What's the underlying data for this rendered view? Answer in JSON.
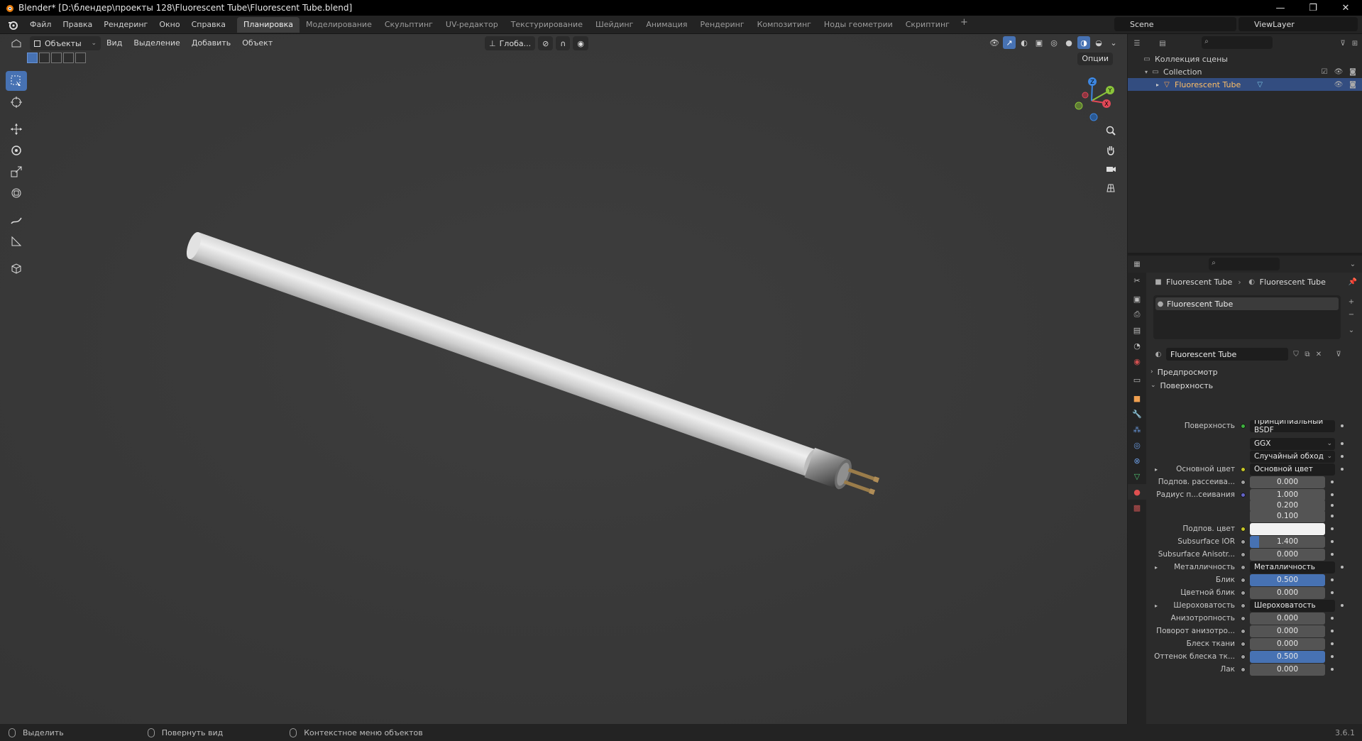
{
  "window": {
    "title": "Blender* [D:\\блендер\\проекты 128\\Fluorescent Tube\\Fluorescent Tube.blend]",
    "controls": [
      "—",
      "❐",
      "✕"
    ]
  },
  "menu": {
    "items": [
      "Файл",
      "Правка",
      "Рендеринг",
      "Окно",
      "Справка"
    ],
    "workspaces": [
      "Планировка",
      "Моделирование",
      "Скульптинг",
      "UV-редактор",
      "Текстурирование",
      "Шейдинг",
      "Анимация",
      "Рендеринг",
      "Композитинг",
      "Ноды геометрии",
      "Скриптинг"
    ],
    "active_workspace": "Планировка",
    "scene": "Scene",
    "view_layer": "ViewLayer"
  },
  "viewport": {
    "mode": "Объекты",
    "menus": [
      "Вид",
      "Выделение",
      "Добавить",
      "Объект"
    ],
    "orientation": "Глоба...",
    "options": "Опции",
    "gizmo_axes": {
      "x": "X",
      "y": "Y",
      "z": "Z"
    }
  },
  "outliner": {
    "scene_collection": "Коллекция сцены",
    "collection": "Collection",
    "object": "Fluorescent Tube"
  },
  "properties": {
    "breadcrumb_object": "Fluorescent Tube",
    "breadcrumb_material": "Fluorescent Tube",
    "slot": "Fluorescent Tube",
    "material_name": "Fluorescent Tube",
    "preview_label": "Предпросмотр",
    "surface_panel": "Поверхность",
    "rows": [
      {
        "label": "Поверхность",
        "type": "dark",
        "value": "Принципиальный BSDF",
        "socket": "#3fb33f"
      },
      {
        "label": "",
        "type": "dark",
        "value": "GGX",
        "socket": ""
      },
      {
        "label": "",
        "type": "dark",
        "value": "Случайный обход",
        "socket": ""
      },
      {
        "label": "Основной цвет",
        "type": "dark",
        "value": "Основной цвет",
        "socket": "#c7c729",
        "expand": true
      },
      {
        "label": "Подпов. рассеива...",
        "type": "num",
        "value": "0.000",
        "socket": "#a1a1a1"
      },
      {
        "label": "Радиус п...сеивания",
        "type": "num",
        "value": "1.000",
        "socket": "#6363c7"
      },
      {
        "label": "",
        "type": "num",
        "value": "0.200",
        "socket": ""
      },
      {
        "label": "",
        "type": "num",
        "value": "0.100",
        "socket": ""
      },
      {
        "label": "Подпов. цвет",
        "type": "white",
        "value": "",
        "socket": "#c7c729"
      },
      {
        "label": "Subsurface IOR",
        "type": "numfill",
        "value": "1.400",
        "socket": "#a1a1a1",
        "fill": 0.12
      },
      {
        "label": "Subsurface Anisotr...",
        "type": "num",
        "value": "0.000",
        "socket": "#a1a1a1"
      },
      {
        "label": "Металличность",
        "type": "dark",
        "value": "Металличность",
        "socket": "#a1a1a1",
        "expand": true
      },
      {
        "label": "Блик",
        "type": "blue",
        "value": "0.500",
        "socket": "#a1a1a1"
      },
      {
        "label": "Цветной блик",
        "type": "num",
        "value": "0.000",
        "socket": "#a1a1a1"
      },
      {
        "label": "Шероховатость",
        "type": "dark",
        "value": "Шероховатость",
        "socket": "#a1a1a1",
        "expand": true
      },
      {
        "label": "Анизотропность",
        "type": "num",
        "value": "0.000",
        "socket": "#a1a1a1"
      },
      {
        "label": "Поворот анизотро...",
        "type": "num",
        "value": "0.000",
        "socket": "#a1a1a1"
      },
      {
        "label": "Блеск ткани",
        "type": "num",
        "value": "0.000",
        "socket": "#a1a1a1"
      },
      {
        "label": "Оттенок блеска тк...",
        "type": "blue",
        "value": "0.500",
        "socket": "#a1a1a1"
      },
      {
        "label": "Лак",
        "type": "num",
        "value": "0.000",
        "socket": "#a1a1a1"
      }
    ]
  },
  "statusbar": {
    "select": "Выделить",
    "rotate": "Повернуть вид",
    "context_menu": "Контекстное меню объектов",
    "version": "3.6.1"
  },
  "colors": {
    "accent": "#4772b3",
    "viewport_bg": "#3b3b3b",
    "selected_row": "#334d80"
  }
}
